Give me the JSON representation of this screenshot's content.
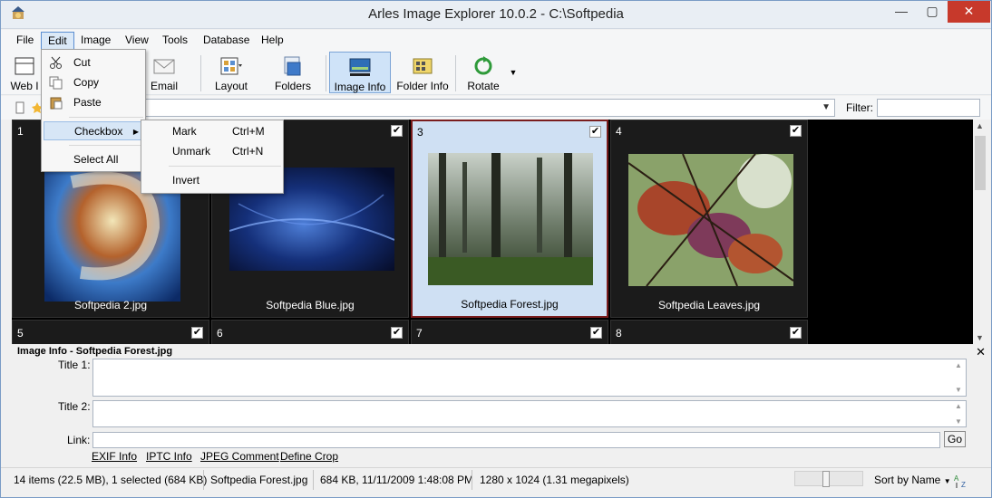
{
  "app": {
    "title": "Arles Image Explorer 10.0.2 - C:\\Softpedia"
  },
  "menubar": {
    "items": [
      "File",
      "Edit",
      "Image",
      "View",
      "Tools",
      "Database",
      "Help"
    ]
  },
  "toolbar": {
    "web_label": "Web I",
    "email_label": "Email",
    "layout_label": "Layout",
    "folders_label": "Folders",
    "image_info_label": "Image Info",
    "folder_info_label": "Folder Info",
    "rotate_label": "Rotate"
  },
  "addressbar": {
    "path_value": "",
    "filter_label": "Filter:",
    "filter_value": ""
  },
  "edit_menu": {
    "cut": "Cut",
    "copy": "Copy",
    "paste": "Paste",
    "checkbox": "Checkbox",
    "select_all": "Select All"
  },
  "checkbox_submenu": {
    "mark": "Mark",
    "mark_shortcut": "Ctrl+M",
    "unmark": "Unmark",
    "unmark_shortcut": "Ctrl+N",
    "invert": "Invert"
  },
  "gallery": {
    "thumbnails": [
      {
        "index": "1",
        "name": "Softpedia 2.jpg",
        "checked": true,
        "selected": false
      },
      {
        "index": "2",
        "name": "Softpedia Blue.jpg",
        "checked": true,
        "selected": false
      },
      {
        "index": "3",
        "name": "Softpedia Forest.jpg",
        "checked": true,
        "selected": true
      },
      {
        "index": "4",
        "name": "Softpedia Leaves.jpg",
        "checked": true,
        "selected": false
      }
    ],
    "row2": [
      {
        "index": "5",
        "checked": true
      },
      {
        "index": "6",
        "checked": true
      },
      {
        "index": "7",
        "checked": true
      },
      {
        "index": "8",
        "checked": true
      }
    ],
    "checkmark": "✔"
  },
  "info_panel": {
    "title": "Image Info - Softpedia Forest.jpg",
    "title1_label": "Title 1:",
    "title2_label": "Title 2:",
    "link_label": "Link:",
    "go_button": "Go",
    "links": [
      "EXIF Info",
      "IPTC Info",
      "JPEG Comment",
      "Define Crop"
    ]
  },
  "statusbar": {
    "items_summary": "14 items (22.5 MB), 1 selected (684 KB)",
    "selected_file": "Softpedia Forest.jpg",
    "file_details": "684 KB, 11/11/2009 1:48:08 PM",
    "dimensions": "1280 x 1024 (1.31 megapixels)",
    "sort_label": "Sort by Name",
    "zoom_level": 0.45
  },
  "colors": {
    "accent": "#5b8ed1",
    "selection_border": "#7a1d1d",
    "close_button": "#c7392b"
  }
}
